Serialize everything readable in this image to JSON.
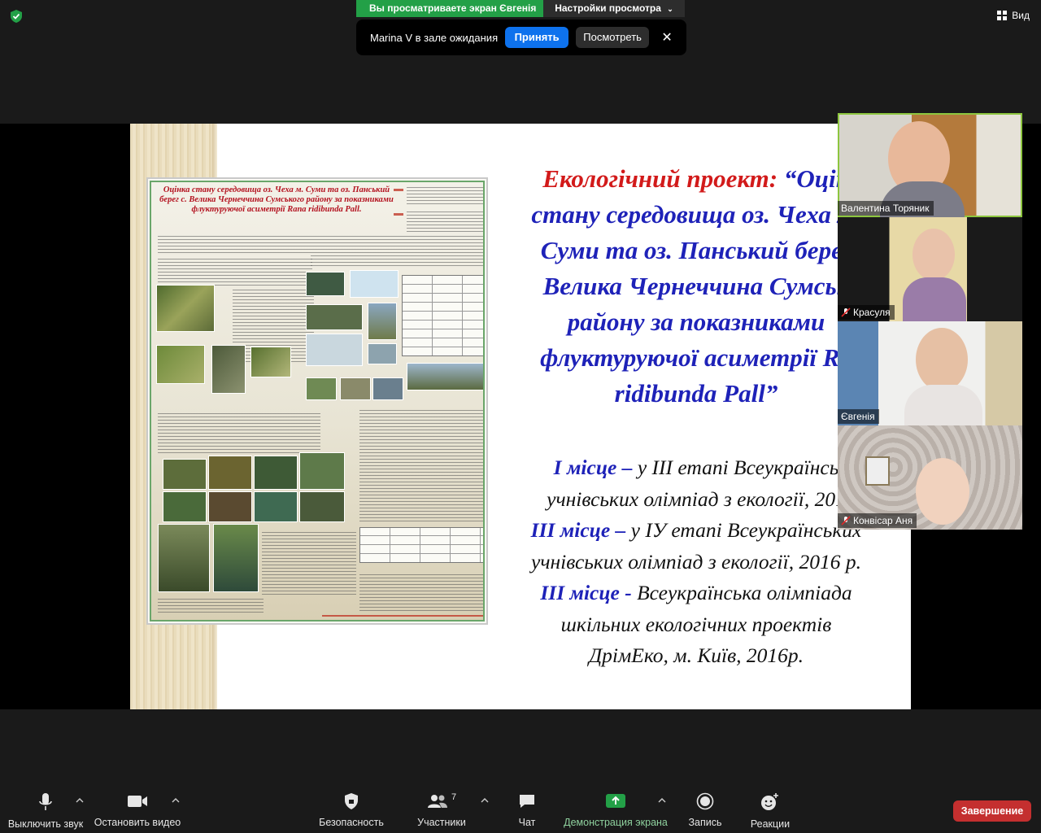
{
  "top": {
    "share_banner": "Вы просматриваете экран Євгенія",
    "view_settings": "Настройки просмотра",
    "view_button": "Вид",
    "waiting_room": {
      "message": "Marina V в зале ожидания",
      "accept": "Принять",
      "view": "Посмотреть",
      "close": "✕"
    }
  },
  "slide": {
    "title_red": "Екологічний проект:",
    "title_blue_lines": [
      "“Оцін",
      "стану середовища оз. Чеха м.",
      "Суми та оз. Панський берег",
      "Велика Чернеччина Сумськ",
      "району за показниками",
      "флуктуруючої асиметрії Ra",
      "ridibunda Pall”"
    ],
    "awards": [
      {
        "place": "І місце –",
        "text": " у ІІІ етапі Всеукраїнсь"
      },
      {
        "place": "",
        "text": "учнівських олімпіад з екології, 201"
      },
      {
        "place": "ІІІ місце –",
        "text": " у ІУ етапі Всеукраїнських"
      },
      {
        "place": "",
        "text": "учнівських олімпіад з екології, 2016 р."
      },
      {
        "place": "ІІІ місце -",
        "text": " Всеукраїнська олімпіада"
      },
      {
        "place": "",
        "text": "шкільних екологічних проектів"
      },
      {
        "place": "",
        "text": "ДрімЕко, м. Київ, 2016р."
      }
    ],
    "poster": {
      "title": "Оцінка стану середовища оз. Чеха м. Суми та оз. Панський берег с. Велика Чернеччина Сумського району за показниками флуктуруючої асиметрії Rana ridibunda Pall."
    }
  },
  "participants": [
    {
      "name": "Валентина Торяник",
      "muted": false,
      "active": true
    },
    {
      "name": "Красуля",
      "muted": true,
      "active": false
    },
    {
      "name": "Євгенія",
      "muted": false,
      "active": false
    },
    {
      "name": "Конвісар Аня",
      "muted": true,
      "active": false
    }
  ],
  "toolbar": {
    "mute": "Выключить звук",
    "stop_video": "Остановить видео",
    "security": "Безопасность",
    "participants": "Участники",
    "participants_count": "7",
    "chat": "Чат",
    "share_screen": "Демонстрация экрана",
    "record": "Запись",
    "reactions": "Реакции",
    "end": "Завершение"
  },
  "colors": {
    "share_green": "#23a047",
    "accept_blue": "#0e72ed",
    "end_red": "#c42f2f",
    "slide_blue": "#1e22b8",
    "slide_red": "#d21a1a"
  }
}
